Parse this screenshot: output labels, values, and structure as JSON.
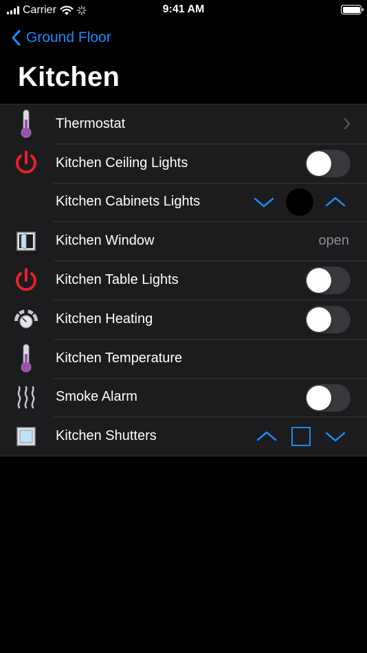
{
  "status_bar": {
    "carrier": "Carrier",
    "time": "9:41 AM"
  },
  "nav": {
    "back_label": "Ground Floor",
    "title": "Kitchen"
  },
  "colors": {
    "accent": "#1a8cff",
    "power_red": "#e8202a",
    "thermo_purple": "#9b4fb5",
    "row_bg": "#1c1c1e",
    "value_gray": "#8e8e93"
  },
  "rows": [
    {
      "label": "Thermostat",
      "icon": "thermometer-icon",
      "control": "chevron"
    },
    {
      "label": "Kitchen Ceiling Lights",
      "icon": "power-icon",
      "control": "toggle",
      "on": false
    },
    {
      "label": "Kitchen Cabinets Lights",
      "icon": "",
      "control": "dimmer"
    },
    {
      "label": "Kitchen Window",
      "icon": "window-icon",
      "control": "value",
      "value": "open"
    },
    {
      "label": "Kitchen Table Lights",
      "icon": "power-icon",
      "control": "toggle",
      "on": false
    },
    {
      "label": "Kitchen Heating",
      "icon": "gauge-icon",
      "control": "toggle",
      "on": false
    },
    {
      "label": "Kitchen Temperature",
      "icon": "thermometer-icon",
      "control": "none"
    },
    {
      "label": "Smoke Alarm",
      "icon": "smoke-icon",
      "control": "toggle",
      "on": false
    },
    {
      "label": "Kitchen Shutters",
      "icon": "shutter-icon",
      "control": "shutter"
    }
  ]
}
